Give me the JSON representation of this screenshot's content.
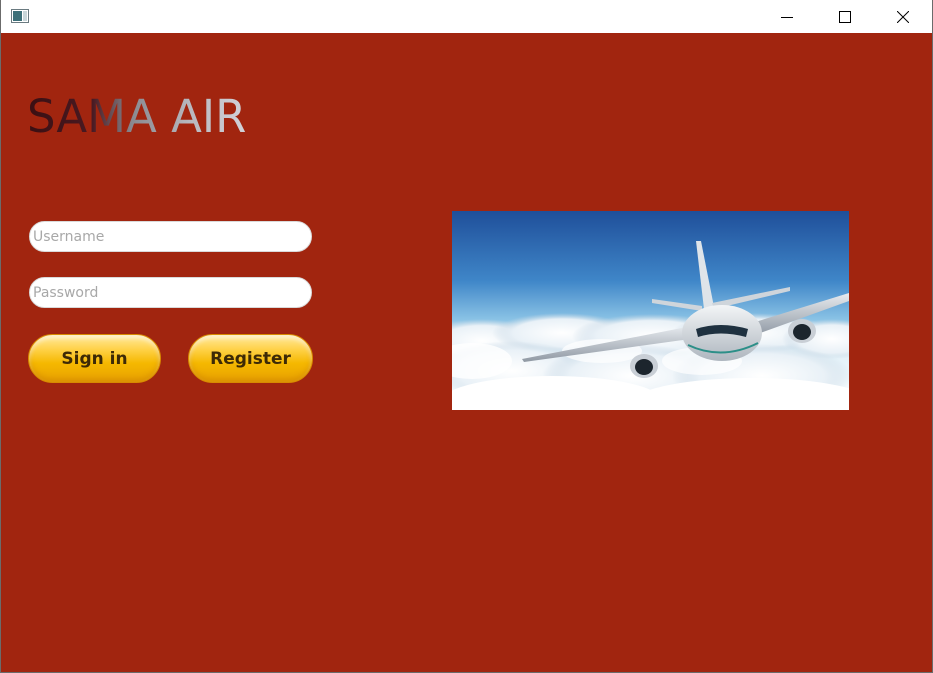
{
  "titlebar": {
    "icons": {
      "app": "window-app-icon",
      "minimize": "minimize-icon",
      "maximize": "maximize-icon",
      "close": "close-icon"
    }
  },
  "brand": {
    "title": "SAMA AIR"
  },
  "login": {
    "username_placeholder": "Username",
    "username_value": "",
    "password_placeholder": "Password",
    "password_value": "",
    "signin_label": "Sign in",
    "register_label": "Register"
  },
  "colors": {
    "background": "#a1250f",
    "button_yellow": "#f5b800",
    "titlebar": "#ffffff"
  },
  "image": {
    "subject": "airplane-above-clouds"
  }
}
